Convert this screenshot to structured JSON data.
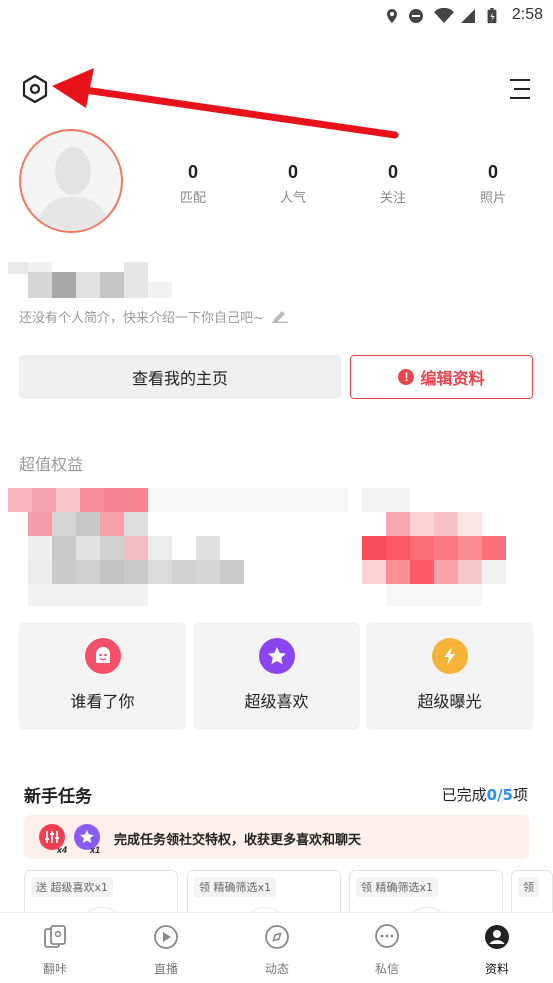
{
  "status_bar": {
    "time": "2:58"
  },
  "profile": {
    "stats": [
      {
        "value": "0",
        "label": "匹配"
      },
      {
        "value": "0",
        "label": "人气"
      },
      {
        "value": "0",
        "label": "关注"
      },
      {
        "value": "0",
        "label": "照片"
      }
    ],
    "bio_placeholder": "还没有个人简介，快来介绍一下你自己吧~"
  },
  "actions": {
    "view_home": "查看我的主页",
    "edit_profile": "编辑资料",
    "edit_alert": "!"
  },
  "benefits": {
    "title": "超值权益",
    "cards": [
      {
        "label": "谁看了你",
        "icon": "face-icon",
        "color": "#f5506a"
      },
      {
        "label": "超级喜欢",
        "icon": "star-icon",
        "color": "#8a45f0"
      },
      {
        "label": "超级曝光",
        "icon": "lightning-icon",
        "color": "#f5b338"
      }
    ]
  },
  "tasks": {
    "title": "新手任务",
    "progress_prefix": "已完成",
    "progress_done": "0",
    "progress_total": "/5",
    "progress_suffix": "项",
    "banner_text": "完成任务领社交特权，收获更多喜欢和聊天",
    "badge1": "x4",
    "badge2": "x1",
    "items": [
      {
        "tag": "送 超级喜欢x1"
      },
      {
        "tag": "领 精确筛选x1"
      },
      {
        "tag": "领 精确筛选x1"
      },
      {
        "tag": "领"
      }
    ]
  },
  "bottom_nav": [
    {
      "label": "翻咔",
      "active": false
    },
    {
      "label": "直播",
      "active": false
    },
    {
      "label": "动态",
      "active": false
    },
    {
      "label": "私信",
      "active": false
    },
    {
      "label": "资料",
      "active": true
    }
  ],
  "colors": {
    "accent_red": "#e8454f",
    "blue": "#2a8ef7",
    "annotation_arrow": "#e8121a"
  }
}
